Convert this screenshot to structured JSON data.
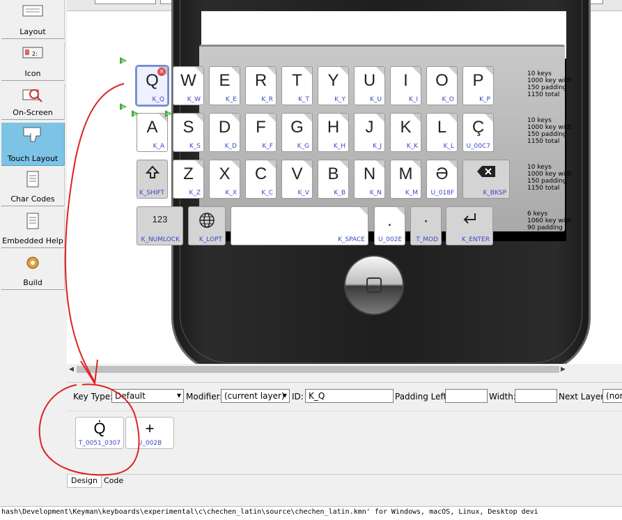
{
  "sidebar": {
    "items": [
      {
        "label": "Layout",
        "icon": "keyboard-icon"
      },
      {
        "label": "Icon",
        "icon": "icon-editor-icon"
      },
      {
        "label": "On-Screen",
        "icon": "onscreen-keyboard-icon"
      },
      {
        "label": "Touch Layout",
        "icon": "touch-keyboard-icon",
        "active": true
      },
      {
        "label": "Char Codes",
        "icon": "document-icon"
      },
      {
        "label": "Embedded Help",
        "icon": "help-document-icon"
      },
      {
        "label": "Build",
        "icon": "gear-icon"
      }
    ]
  },
  "keyboard": {
    "rows": [
      {
        "info": [
          "10 keys",
          "1000 key widt",
          "150 padding",
          "1150 total"
        ],
        "keys": [
          {
            "cap": "Q",
            "id": "K_Q",
            "selected": true
          },
          {
            "cap": "W",
            "id": "K_W"
          },
          {
            "cap": "E",
            "id": "K_E"
          },
          {
            "cap": "R",
            "id": "K_R"
          },
          {
            "cap": "T",
            "id": "K_T"
          },
          {
            "cap": "Y",
            "id": "K_Y"
          },
          {
            "cap": "U",
            "id": "K_U"
          },
          {
            "cap": "I",
            "id": "K_I"
          },
          {
            "cap": "O",
            "id": "K_O"
          },
          {
            "cap": "P",
            "id": "K_P"
          }
        ]
      },
      {
        "info": [
          "10 keys",
          "1000 key widt",
          "150 padding",
          "1150 total"
        ],
        "keys": [
          {
            "cap": "A",
            "id": "K_A"
          },
          {
            "cap": "S",
            "id": "K_S"
          },
          {
            "cap": "D",
            "id": "K_D"
          },
          {
            "cap": "F",
            "id": "K_F"
          },
          {
            "cap": "G",
            "id": "K_G"
          },
          {
            "cap": "H",
            "id": "K_H"
          },
          {
            "cap": "J",
            "id": "K_J"
          },
          {
            "cap": "K",
            "id": "K_K"
          },
          {
            "cap": "L",
            "id": "K_L"
          },
          {
            "cap": "Ç",
            "id": "U_00C7"
          }
        ]
      },
      {
        "info": [
          "10 keys",
          "1000 key widt",
          "150 padding",
          "1150 total"
        ],
        "keys": [
          {
            "cap": "",
            "id": "K_SHIFT",
            "icon": "shift-icon"
          },
          {
            "cap": "Z",
            "id": "K_Z"
          },
          {
            "cap": "X",
            "id": "K_X"
          },
          {
            "cap": "C",
            "id": "K_C"
          },
          {
            "cap": "V",
            "id": "K_V"
          },
          {
            "cap": "B",
            "id": "K_B"
          },
          {
            "cap": "N",
            "id": "K_N"
          },
          {
            "cap": "M",
            "id": "K_M"
          },
          {
            "cap": "Ə",
            "id": "U_018F"
          },
          {
            "cap": "",
            "id": "K_BKSP",
            "icon": "backspace-icon"
          }
        ]
      },
      {
        "info": [
          "6 keys",
          "1060 key widt",
          "90 padding",
          "1150 total"
        ],
        "keys": [
          {
            "cap": "123",
            "id": "K_NUMLOCK"
          },
          {
            "cap": "",
            "id": "K_LOPT",
            "icon": "globe-icon"
          },
          {
            "cap": "",
            "id": "K_SPACE"
          },
          {
            "cap": ".",
            "id": "U_002E"
          },
          {
            "cap": "·",
            "id": "T_MOD"
          },
          {
            "cap": "",
            "id": "K_ENTER",
            "icon": "enter-icon"
          }
        ]
      }
    ]
  },
  "props": {
    "key_type_label": "Key Type:",
    "key_type_value": "Default",
    "modifier_label": "Modifier:",
    "modifier_value": "(current layer)",
    "id_label": "ID:",
    "id_value": "K_Q",
    "padding_left_label": "Padding Left:",
    "padding_left_value": "",
    "width_label": "Width:",
    "width_value": "",
    "next_layer_label": "Next Layer:",
    "next_layer_value": "(nor"
  },
  "subkeys": [
    {
      "cap": "Q̇",
      "id": "T_0051_0307"
    },
    {
      "cap": "+",
      "id": "U_002B"
    }
  ],
  "tabs": [
    {
      "label": "Design",
      "active": true
    },
    {
      "label": "Code",
      "active": false
    }
  ],
  "console": {
    "line1": "hash\\Development\\Keyman\\keyboards\\experimental\\c\\chechen_latin\\source\\chechen_latin.kmn' for Windows, macOS, Linux, Desktop devi",
    "line2": ""
  },
  "colors": {
    "accent": "#7cc3e6",
    "key_id": "#3a46c8",
    "annotation": "#e02020"
  }
}
